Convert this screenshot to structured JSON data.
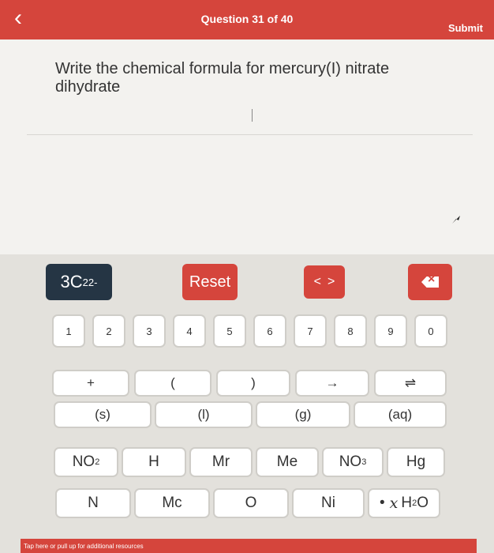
{
  "header": {
    "question_count": "Question 31 of 40",
    "submit_label": "Submit",
    "back_icon": "‹"
  },
  "question": {
    "text": "Write the chemical formula for mercury(I) nitrate dihydrate"
  },
  "formula_display": {
    "coefficient": "3",
    "symbol": "C",
    "subscript": "2",
    "superscript": "2-"
  },
  "controls": {
    "reset_label": "Reset",
    "nav_left": "<",
    "nav_right": ">"
  },
  "numbers": [
    "1",
    "2",
    "3",
    "4",
    "5",
    "6",
    "7",
    "8",
    "9",
    "0"
  ],
  "symbols": {
    "plus": "+",
    "open_paren": "(",
    "close_paren": ")",
    "arrow": "→",
    "equilibrium": "⇌"
  },
  "states": [
    "(s)",
    "(l)",
    "(g)",
    "(aq)"
  ],
  "elements": {
    "no2_base": "NO",
    "no2_sub": "2",
    "h": "H",
    "mr": "Mr",
    "me": "Me",
    "no3_base": "NO",
    "no3_sub": "3",
    "hg": "Hg",
    "n": "N",
    "mc": "Mc",
    "o": "O",
    "ni": "Ni",
    "hydrate_dot": "•",
    "hydrate_x": "x",
    "hydrate_h": "H",
    "hydrate_sub": "2",
    "hydrate_o": "O"
  },
  "footer": {
    "text": "Tap here or pull up for additional resources"
  },
  "colors": {
    "accent_red": "#d5453c",
    "display_navy": "#253544"
  }
}
